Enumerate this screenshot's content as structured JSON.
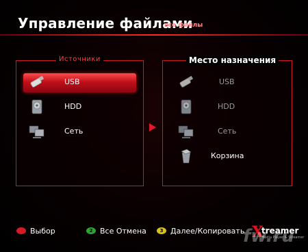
{
  "header": {
    "title": "Управление файлами",
    "subtitle": "все файлы"
  },
  "source_panel": {
    "heading": "Источники",
    "items": [
      {
        "label": "USB",
        "icon": "usb-drive-icon",
        "selected": true
      },
      {
        "label": "HDD",
        "icon": "hard-drive-icon",
        "selected": false
      },
      {
        "label": "Сеть",
        "icon": "network-icon",
        "selected": false
      }
    ]
  },
  "destination_panel": {
    "heading": "Место назначения",
    "items": [
      {
        "label": "USB",
        "icon": "usb-drive-icon"
      },
      {
        "label": "HDD",
        "icon": "hard-drive-icon"
      },
      {
        "label": "Сеть",
        "icon": "network-icon"
      },
      {
        "label": "Корзина",
        "icon": "trash-icon"
      }
    ]
  },
  "footer": {
    "buttons": [
      {
        "color": "#d81a24",
        "num": "",
        "label": "Выбор"
      },
      {
        "color": "#2aa62a",
        "num": "2",
        "label": "Все Отмена"
      },
      {
        "color": "#d8c21a",
        "num": "3",
        "label": "Далее/Копировать"
      }
    ]
  },
  "brand": {
    "logo_text": "treamer",
    "logo_sub": "Media Player & Streamer",
    "watermark": "fw.ru"
  },
  "colors": {
    "accent": "#e21828",
    "panel_border": "#d01820",
    "selected_top": "#ff4b4b",
    "selected_bottom": "#8a0610"
  }
}
